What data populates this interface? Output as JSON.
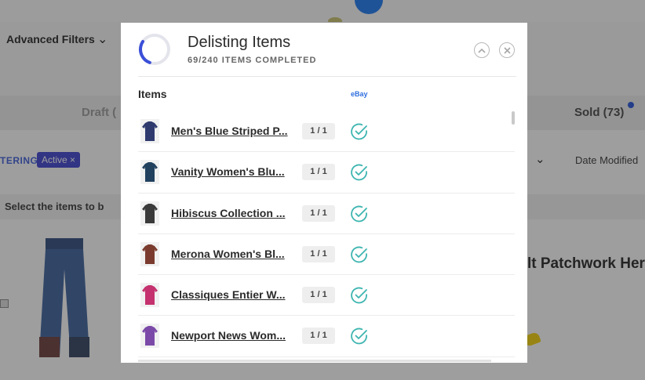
{
  "background": {
    "advanced_filters": "Advanced Filters",
    "tab_draft": "Draft (",
    "tab_sold": "Sold (73)",
    "filtering_label": "TERING",
    "active_chip": "Active ×",
    "date_modified": "Date Modified",
    "select_items": "Select the items to b",
    "product_title": "lt Patchwork Her"
  },
  "modal": {
    "title": "Delisting Items",
    "subtitle": "69/240 ITEMS COMPLETED",
    "progress": 0.2875,
    "col_items": "Items",
    "col_marketplace": "eBay",
    "items": [
      {
        "name": "Men's Blue Striped P...",
        "qty": "1 / 1",
        "color": "#2e3a6e"
      },
      {
        "name": "Vanity Women's Blu...",
        "qty": "1 / 1",
        "color": "#20405e"
      },
      {
        "name": "Hibiscus Collection ...",
        "qty": "1 / 1",
        "color": "#3a3a3a"
      },
      {
        "name": "Merona Women's Bl...",
        "qty": "1 / 1",
        "color": "#7a3b2e"
      },
      {
        "name": "Classiques Entier W...",
        "qty": "1 / 1",
        "color": "#c4316e"
      },
      {
        "name": "Newport News Wom...",
        "qty": "1 / 1",
        "color": "#7b4aa8"
      }
    ],
    "accent_color": "#3b4fd8",
    "check_color": "#3db5b0"
  }
}
